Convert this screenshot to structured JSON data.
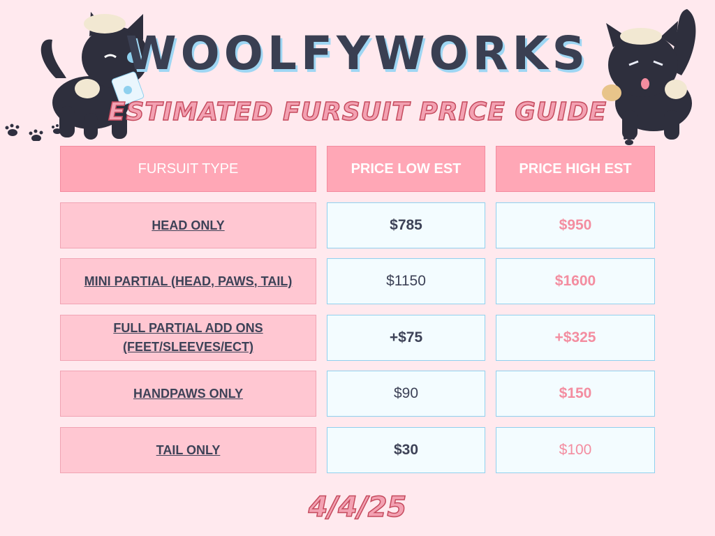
{
  "header": {
    "brand": "WOOLFYWORKS",
    "subtitle": "ESTIMATED FURSUIT PRICE GUIDE"
  },
  "table": {
    "columns": [
      "FURSUIT TYPE",
      "PRICE LOW EST",
      "PRICE HIGH EST"
    ],
    "rows": [
      {
        "type": "HEAD ONLY",
        "low": "$785",
        "high": "$950"
      },
      {
        "type": "MINI PARTIAL (HEAD, PAWS, TAIL)",
        "low": "$1150",
        "high": "$1600"
      },
      {
        "type": "FULL PARTIAL ADD ONS (FEET/SLEEVES/ECT)",
        "low": "+$75",
        "high": "+$325"
      },
      {
        "type": "HANDPAWS ONLY",
        "low": "$90",
        "high": "$150"
      },
      {
        "type": "TAIL ONLY",
        "low": "$30",
        "high": "$100"
      }
    ]
  },
  "footer": {
    "date": "4/4/25"
  },
  "colors": {
    "background": "#ffe9ee",
    "header_fill": "#ffa7b6",
    "type_fill": "#ffc7d2",
    "value_fill": "#f3fcff",
    "value_border": "#8fd0ee",
    "title_text": "#3a3f52",
    "accent_pink": "#f38da0"
  },
  "icons": [
    "wolf-mascot-left",
    "wolf-mascot-right",
    "paw-print-icon"
  ]
}
